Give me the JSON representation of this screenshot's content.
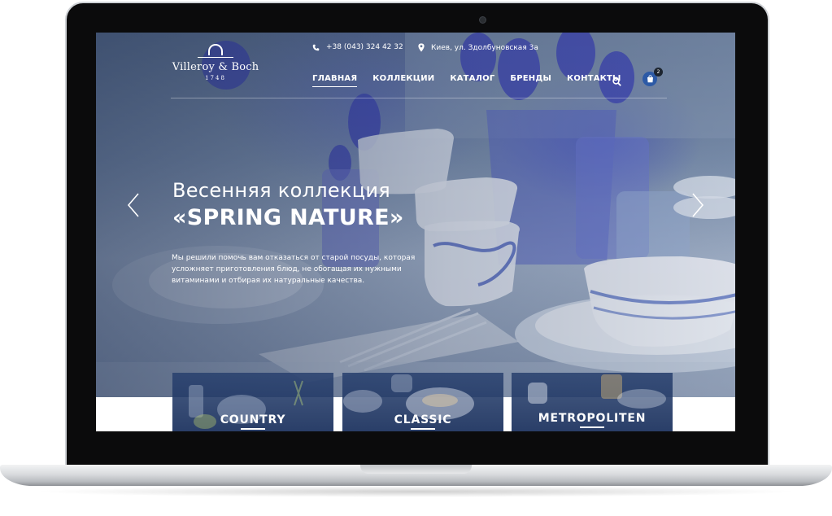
{
  "site": {
    "logo": {
      "name": "Villeroy & Boch",
      "year": "1748"
    },
    "contacts": {
      "phone": "+38 (043) 324 42 32",
      "address": "Киев, ул. Здолбуновская 3а"
    },
    "nav": {
      "items": [
        {
          "label": "ГЛАВНАЯ",
          "active": true
        },
        {
          "label": "КОЛЛЕКЦИИ",
          "active": false
        },
        {
          "label": "КАТАЛОГ",
          "active": false
        },
        {
          "label": "БРЕНДЫ",
          "active": false
        },
        {
          "label": "КОНТАКТЫ",
          "active": false
        }
      ]
    },
    "cart": {
      "count": "2"
    }
  },
  "hero": {
    "title": "Весенняя коллекция",
    "subtitle": "«SPRING NATURE»",
    "text": "Мы решили помочь вам отказаться от старой посуды, которая усложняет приготовления блюд, не обогащая их нужными витаминами и отбирая их натуральные качества."
  },
  "categories": [
    {
      "label": "COUNTRY"
    },
    {
      "label": "CLASSIC"
    },
    {
      "label": "METROPOLITEN"
    }
  ],
  "icons": [
    "phone-icon",
    "location-pin-icon",
    "search-icon",
    "cart-icon",
    "arrow-left-icon",
    "arrow-right-icon",
    "camera-icon"
  ],
  "colors": {
    "accent": "#2d5aa6",
    "hero_overlay": "#263656",
    "text": "#ffffff"
  }
}
